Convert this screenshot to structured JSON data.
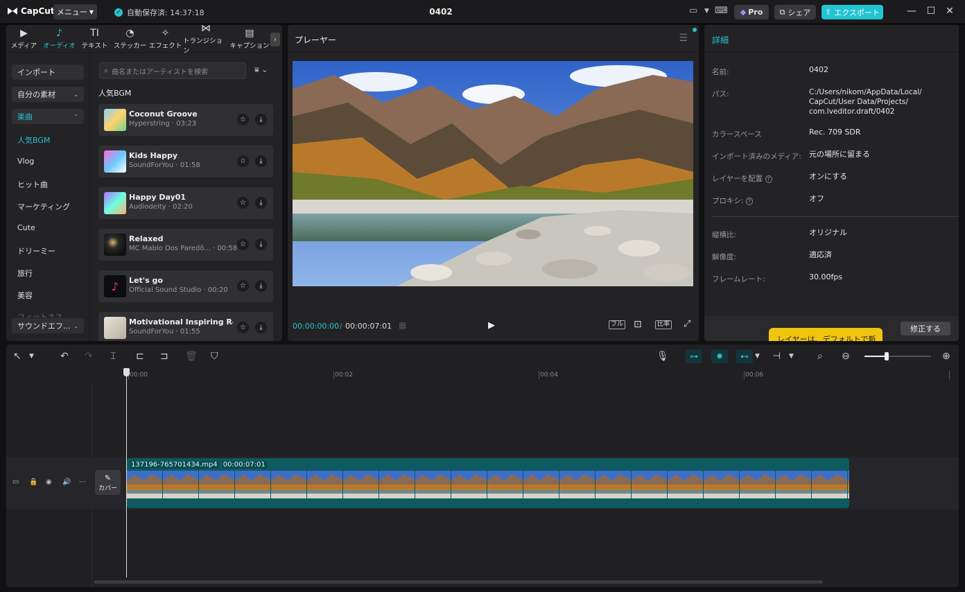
{
  "app": {
    "logo": "CapCut",
    "menu": "メニュー",
    "autosave": "自動保存済: 14:37:18",
    "project_title": "0402",
    "pro": "Pro",
    "share": "シェア",
    "export": "エクスポート"
  },
  "left_tabs": [
    {
      "label": "メディア",
      "icon": "▶"
    },
    {
      "label": "オーディオ",
      "icon": "♪"
    },
    {
      "label": "テキスト",
      "icon": "TI"
    },
    {
      "label": "ステッカー",
      "icon": "◔"
    },
    {
      "label": "エフェクト",
      "icon": "✧"
    },
    {
      "label": "トランジション",
      "icon": "⋈"
    },
    {
      "label": "キャプション",
      "icon": "▤"
    }
  ],
  "sidebar": {
    "import": "インポート",
    "my_assets": "自分の素材",
    "music": "楽曲",
    "categories": [
      "人気BGM",
      "Vlog",
      "ヒット曲",
      "マーケティング",
      "Cute",
      "ドリーミー",
      "旅行",
      "美容",
      "フィットネス"
    ],
    "sound_effects": "サウンドエフ..."
  },
  "audio": {
    "search_placeholder": "曲名またはアーティストを検索",
    "section": "人気BGM",
    "tracks": [
      {
        "title": "Coconut Groove",
        "meta": "Hyperstring · 03:23"
      },
      {
        "title": "Kids Happy",
        "meta": "SoundForYou · 01:58"
      },
      {
        "title": "Happy Day01",
        "meta": "Audiodeity · 02:20"
      },
      {
        "title": "Relaxed",
        "meta": "MC Mablo Dos Paredõ... · 00:58"
      },
      {
        "title": "Let's go",
        "meta": "Official Sound Studio · 00:20"
      },
      {
        "title": "Motivational Inspiring Roc...",
        "meta": "SoundForYou · 01:55"
      }
    ]
  },
  "player": {
    "title": "プレーヤー",
    "current": "00:00:00:00",
    "total": "00:00:07:01",
    "full": "フル",
    "ratio": "比率"
  },
  "details": {
    "title": "詳細",
    "rows": [
      {
        "label": "名前:",
        "value": "0402"
      },
      {
        "label": "パス:",
        "value": "C:/Users/nikom/AppData/Local/\nCapCut/User Data/Projects/\ncom.lveditor.draft/0402"
      },
      {
        "label": "カラースペース",
        "value": "Rec. 709 SDR"
      },
      {
        "label": "インポート済みのメディア:",
        "value": "元の場所に留まる"
      },
      {
        "label": "レイヤーを配置",
        "value": "オンにする"
      },
      {
        "label": "プロキシ:",
        "value": "オフ"
      },
      {
        "label": "縦横比:",
        "value": "オリジナル"
      },
      {
        "label": "解像度:",
        "value": "適応済"
      },
      {
        "label": "フレームレート:",
        "value": "30.00fps"
      }
    ],
    "tooltip": "レイヤーは、デフォルトで新しい",
    "fix": "修正する"
  },
  "timeline": {
    "ticks": [
      "00:00",
      "00:02",
      "00:04",
      "00:06"
    ],
    "cover": "カバー",
    "clip_name": "137196-765701434.mp4",
    "clip_duration": "00:00:07:01"
  },
  "colors": {
    "accent": "#27c2cf",
    "clip": "#0d5a60"
  }
}
